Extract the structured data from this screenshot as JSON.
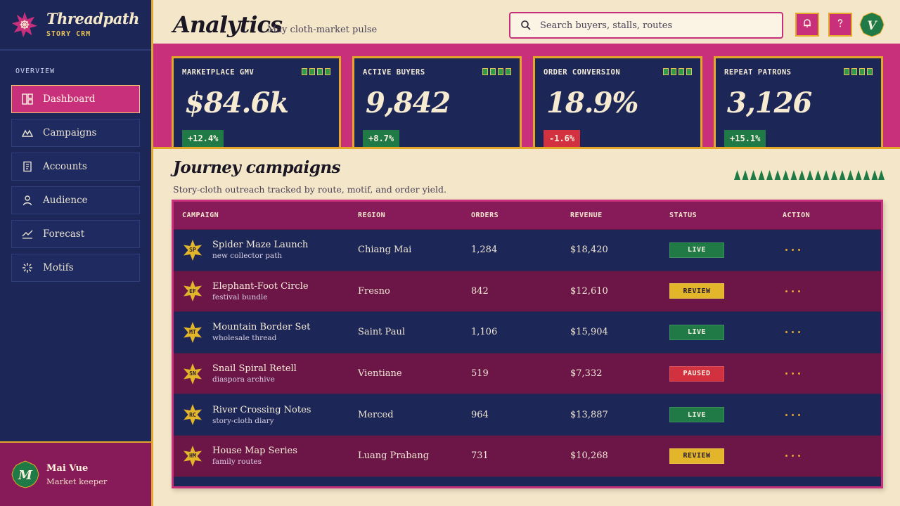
{
  "brand": {
    "name": "Threadpath",
    "subtitle": "STORY CRM"
  },
  "sidebar": {
    "section_label": "OVERVIEW",
    "items": [
      {
        "label": "Dashboard",
        "icon": "dashboard-icon",
        "active": true
      },
      {
        "label": "Campaigns",
        "icon": "mountain-icon",
        "active": false
      },
      {
        "label": "Accounts",
        "icon": "ledger-icon",
        "active": false
      },
      {
        "label": "Audience",
        "icon": "person-icon",
        "active": false
      },
      {
        "label": "Forecast",
        "icon": "trend-icon",
        "active": false
      },
      {
        "label": "Motifs",
        "icon": "sparkle-icon",
        "active": false
      }
    ],
    "user": {
      "name": "Mai Vue",
      "role": "Market keeper",
      "initial": "M"
    }
  },
  "header": {
    "title": "Analytics",
    "subtitle": "May cloth-market pulse",
    "search_placeholder": "Search buyers, stalls, routes",
    "avatar_initial": "V"
  },
  "kpis": [
    {
      "label": "MARKETPLACE GMV",
      "value": "$84.6k",
      "delta": "+12.4%",
      "trend": "up"
    },
    {
      "label": "ACTIVE BUYERS",
      "value": "9,842",
      "delta": "+8.7%",
      "trend": "up"
    },
    {
      "label": "ORDER CONVERSION",
      "value": "18.9%",
      "delta": "-1.6%",
      "trend": "down"
    },
    {
      "label": "REPEAT PATRONS",
      "value": "3,126",
      "delta": "+15.1%",
      "trend": "up"
    }
  ],
  "section": {
    "title": "Journey campaigns",
    "subtitle": "Story-cloth outreach tracked by route, motif, and order yield."
  },
  "table": {
    "columns": [
      "CAMPAIGN",
      "REGION",
      "ORDERS",
      "REVENUE",
      "STATUS",
      "ACTION"
    ],
    "rows": [
      {
        "initials": "SP",
        "name": "Spider Maze Launch",
        "note": "new collector path",
        "region": "Chiang Mai",
        "orders": "1,284",
        "revenue": "$18,420",
        "status": "LIVE"
      },
      {
        "initials": "EF",
        "name": "Elephant-Foot Circle",
        "note": "festival bundle",
        "region": "Fresno",
        "orders": "842",
        "revenue": "$12,610",
        "status": "REVIEW"
      },
      {
        "initials": "MT",
        "name": "Mountain Border Set",
        "note": "wholesale thread",
        "region": "Saint Paul",
        "orders": "1,106",
        "revenue": "$15,904",
        "status": "LIVE"
      },
      {
        "initials": "SN",
        "name": "Snail Spiral Retell",
        "note": "diaspora archive",
        "region": "Vientiane",
        "orders": "519",
        "revenue": "$7,332",
        "status": "PAUSED"
      },
      {
        "initials": "RC",
        "name": "River Crossing Notes",
        "note": "story-cloth diary",
        "region": "Merced",
        "orders": "964",
        "revenue": "$13,887",
        "status": "LIVE"
      },
      {
        "initials": "HM",
        "name": "House Map Series",
        "note": "family routes",
        "region": "Luang Prabang",
        "orders": "731",
        "revenue": "$10,268",
        "status": "REVIEW"
      }
    ]
  },
  "colors": {
    "navy": "#1c2657",
    "magenta": "#c9307c",
    "plum": "#871a58",
    "gold": "#e3a82a",
    "green": "#1f7a45",
    "cream": "#f3e6c9",
    "live": "#1f7a45",
    "review": "#e3b52a",
    "paused": "#d23140"
  }
}
